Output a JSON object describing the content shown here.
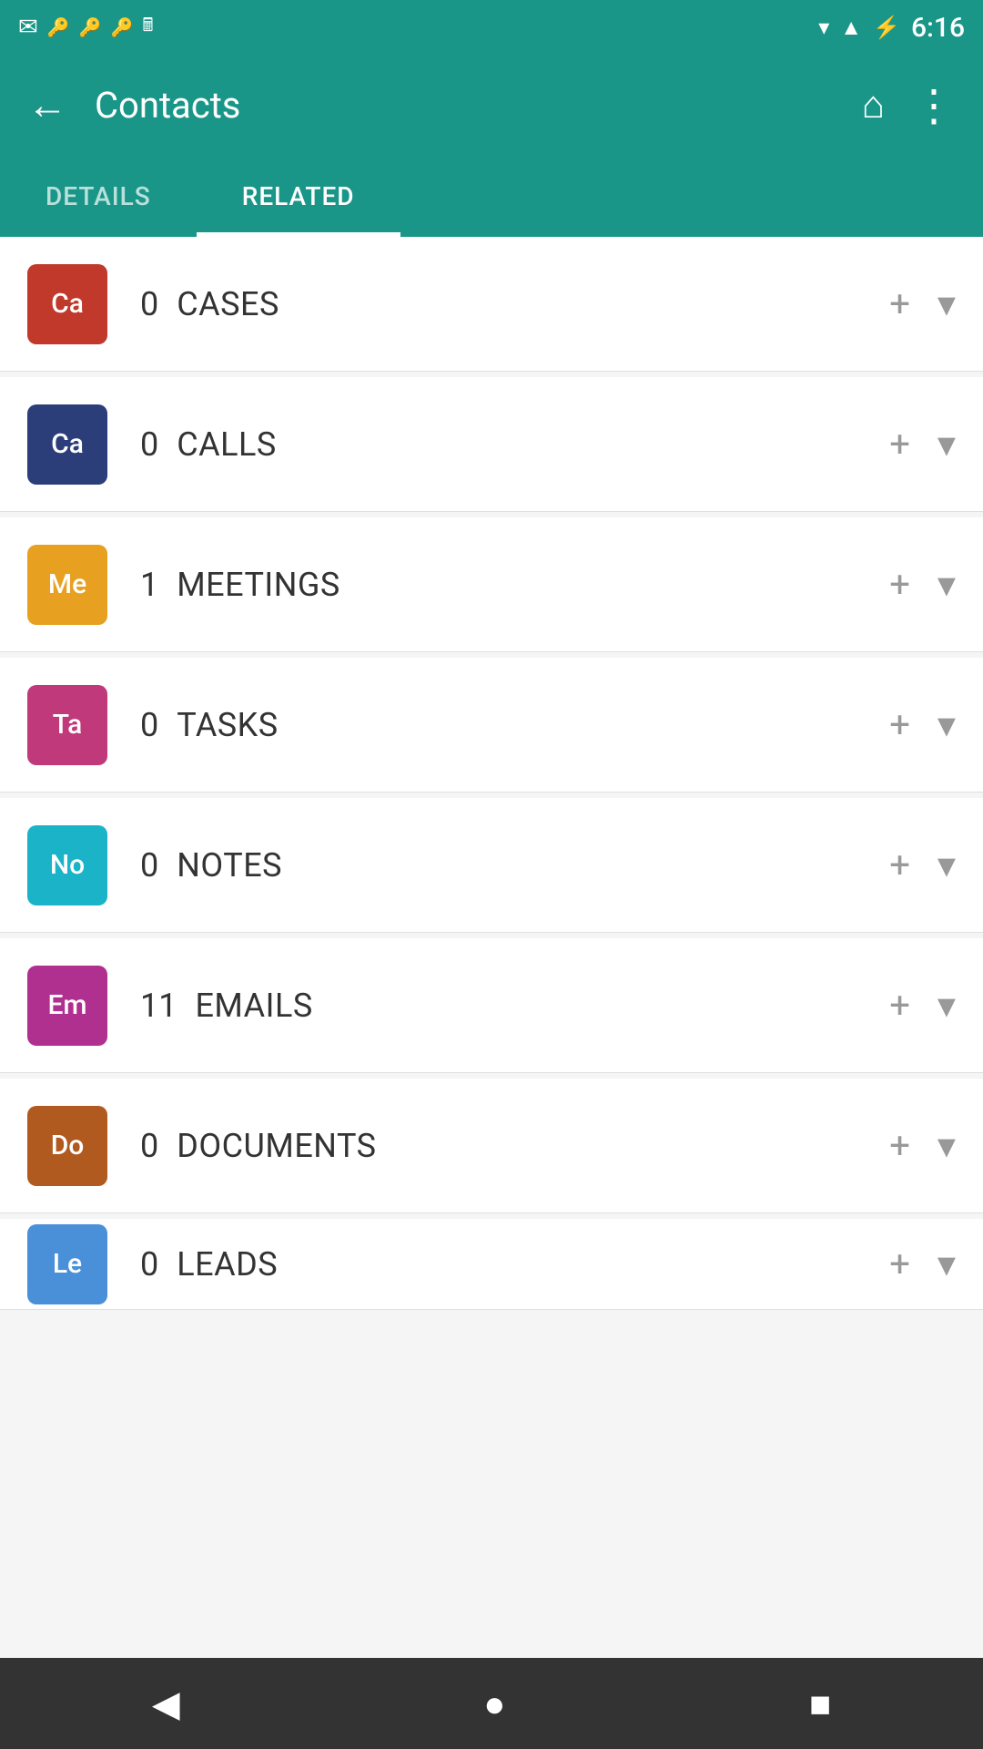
{
  "statusBar": {
    "time": "6:16",
    "icons": [
      "mail",
      "wifi",
      "signal",
      "battery"
    ]
  },
  "appBar": {
    "title": "Contacts",
    "backIcon": "←",
    "homeIcon": "⌂",
    "menuIcon": "⋮"
  },
  "tabs": [
    {
      "id": "details",
      "label": "DETAILS",
      "active": false
    },
    {
      "id": "related",
      "label": "RELATED",
      "active": true
    }
  ],
  "listItems": [
    {
      "id": "cases",
      "iconText": "Ca",
      "iconColor": "#c0392b",
      "count": "0",
      "label": "CASES"
    },
    {
      "id": "calls",
      "iconText": "Ca",
      "iconColor": "#2c3e7a",
      "count": "0",
      "label": "CALLS"
    },
    {
      "id": "meetings",
      "iconText": "Me",
      "iconColor": "#e8a020",
      "count": "1",
      "label": "MEETINGS"
    },
    {
      "id": "tasks",
      "iconText": "Ta",
      "iconColor": "#c0397a",
      "count": "0",
      "label": "TASKS"
    },
    {
      "id": "notes",
      "iconText": "No",
      "iconColor": "#1ab3c8",
      "count": "0",
      "label": "NOTES"
    },
    {
      "id": "emails",
      "iconText": "Em",
      "iconColor": "#b03090",
      "count": "11",
      "label": "EMAILS"
    },
    {
      "id": "documents",
      "iconText": "Do",
      "iconColor": "#b05a20",
      "count": "0",
      "label": "DOCUMENTS"
    },
    {
      "id": "leads",
      "iconText": "Le",
      "iconColor": "#4a90d9",
      "count": "0",
      "label": "LEADS"
    }
  ],
  "bottomNav": {
    "backIcon": "◀",
    "homeIcon": "●",
    "recentIcon": "■"
  }
}
